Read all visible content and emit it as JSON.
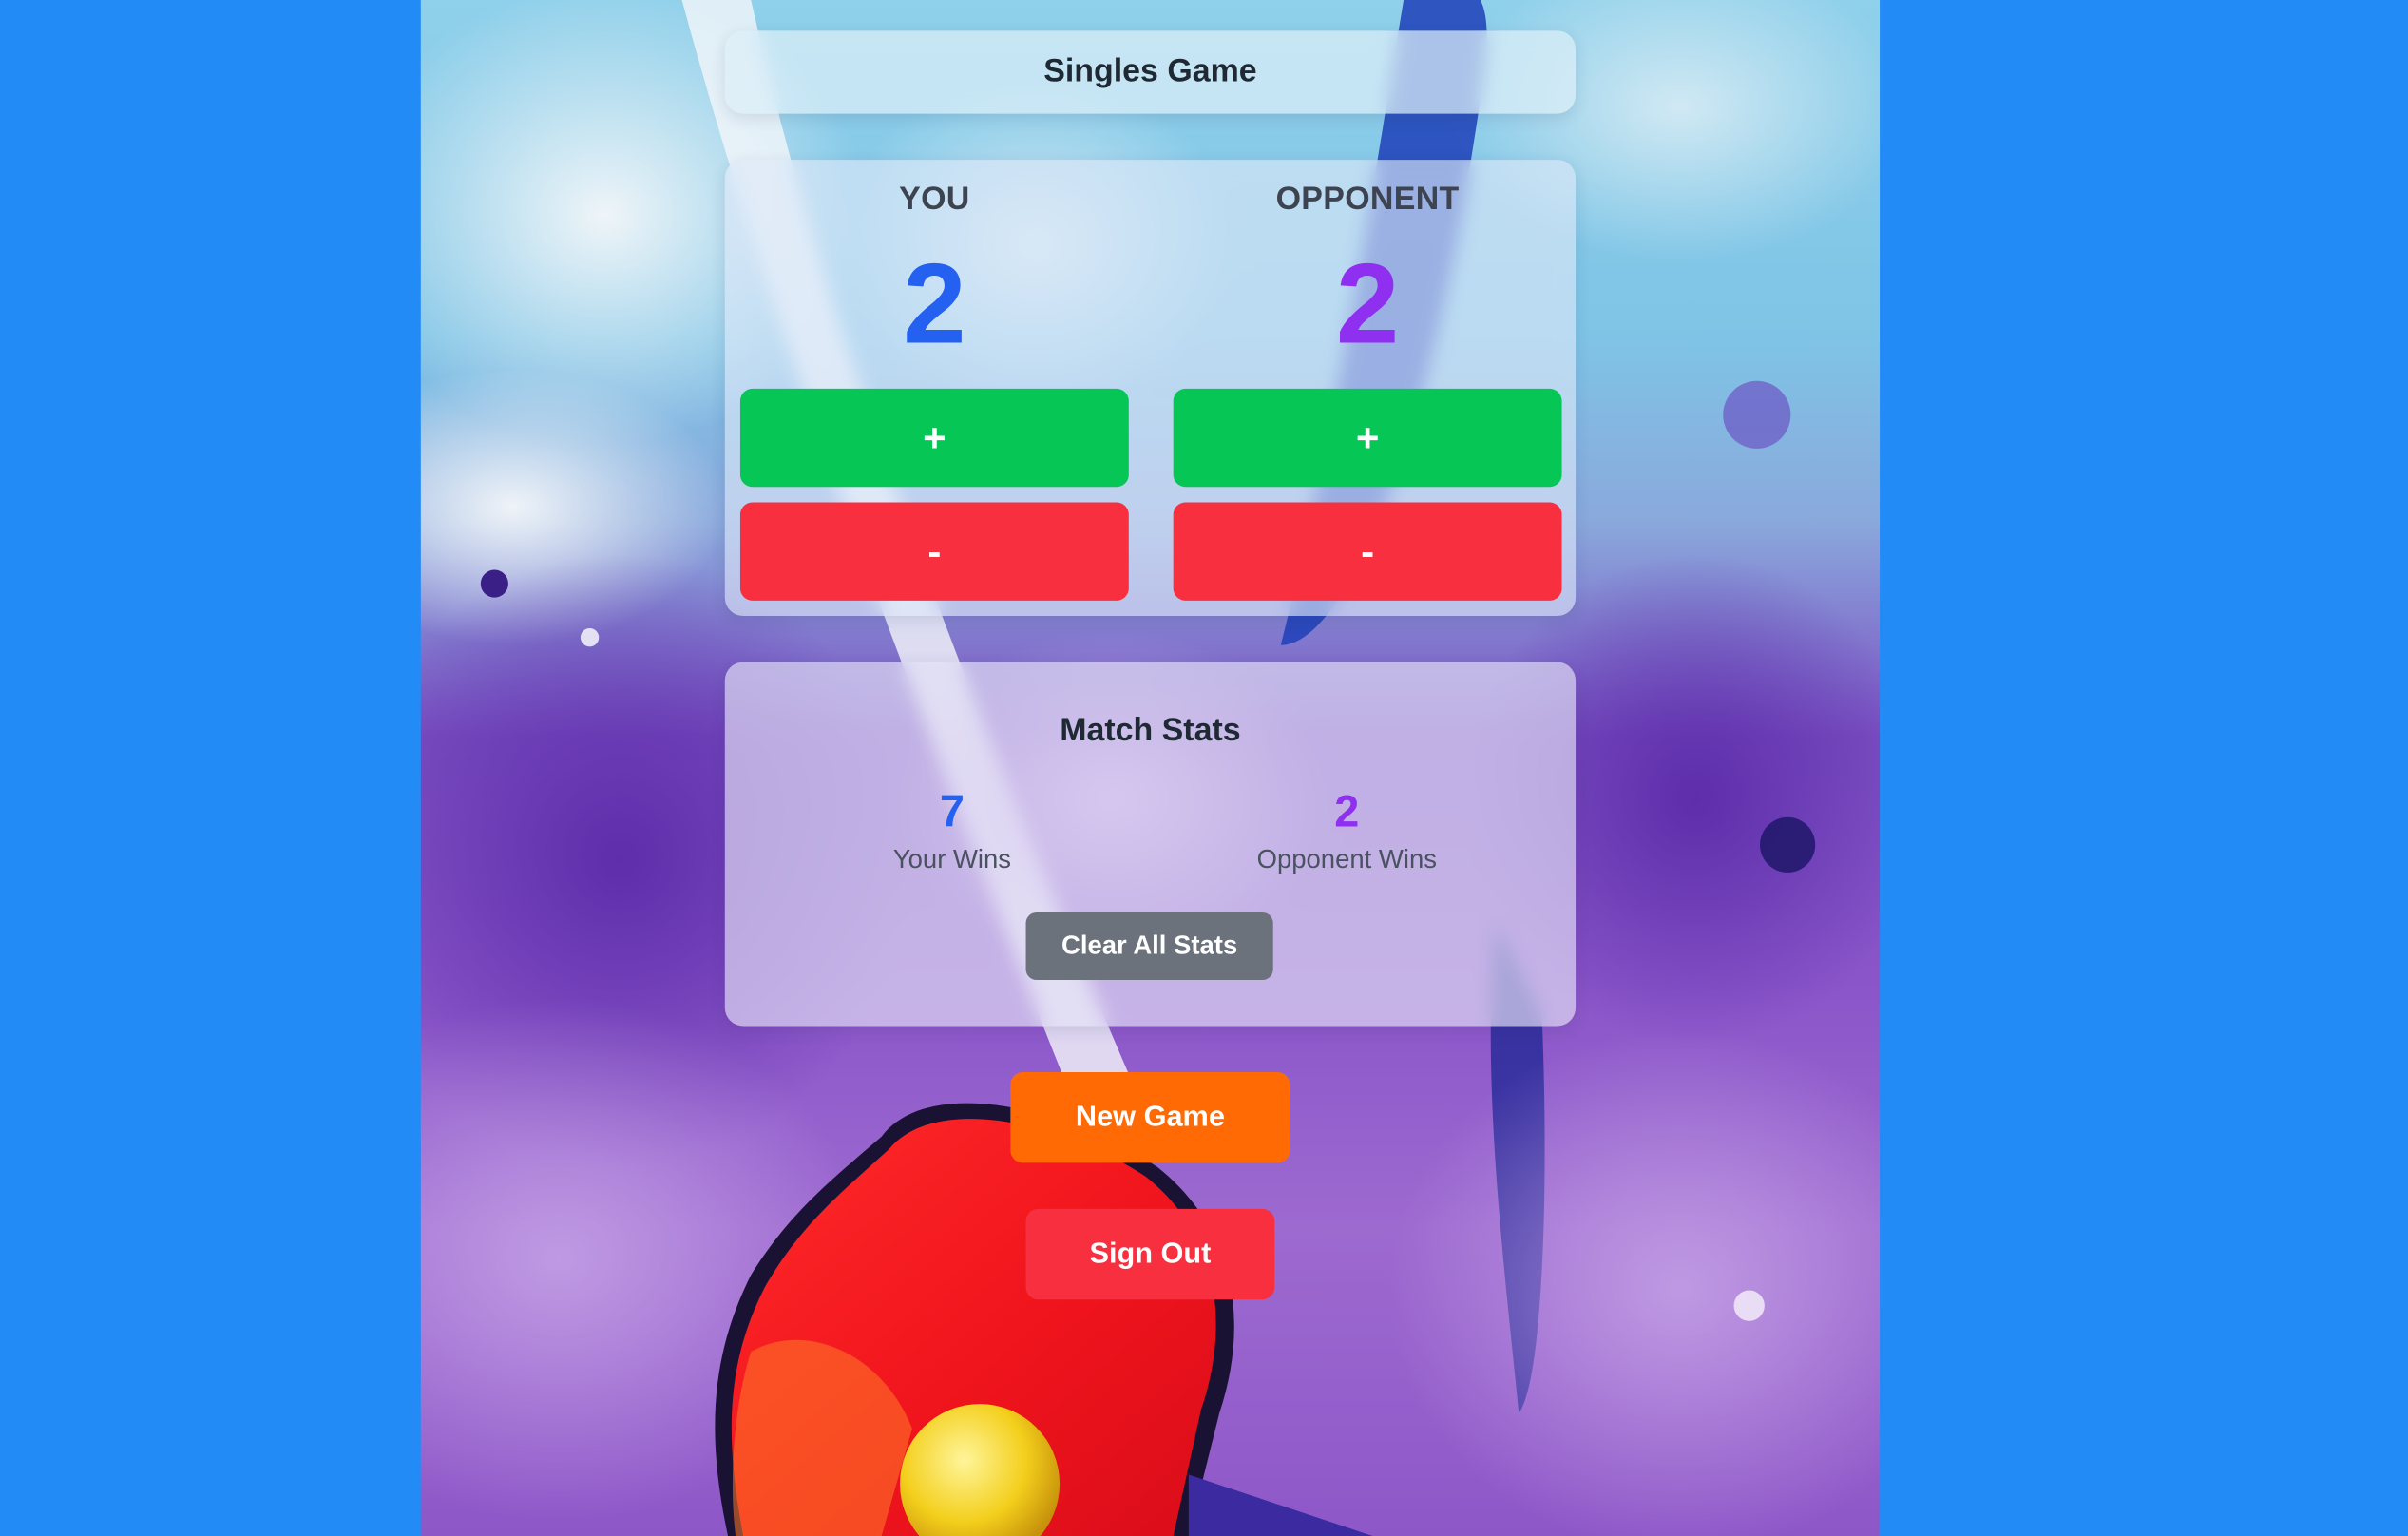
{
  "header": {
    "title": "Singles Game"
  },
  "scoreboard": {
    "you": {
      "label": "YOU",
      "score": "2",
      "color": "#2461f0",
      "plus_label": "+",
      "minus_label": "-"
    },
    "opponent": {
      "label": "OPPONENT",
      "score": "2",
      "color": "#8f2ff0",
      "plus_label": "+",
      "minus_label": "-"
    }
  },
  "stats": {
    "title": "Match Stats",
    "your_wins": {
      "value": "7",
      "label": "Your Wins",
      "color": "#2461f0"
    },
    "opponent_wins": {
      "value": "2",
      "label": "Opponent Wins",
      "color": "#8f2ff0"
    },
    "clear_label": "Clear All Stats"
  },
  "actions": {
    "new_game_label": "New Game",
    "sign_out_label": "Sign Out"
  },
  "colors": {
    "page_background": "#238bf6",
    "plus_button": "#06c655",
    "minus_button": "#f82f3f",
    "new_game_button": "#ff6a05",
    "sign_out_button": "#f82f3f",
    "clear_button": "#6c727b"
  },
  "background_image": {
    "icon": "pickleball-paddle-watercolor-illustration"
  }
}
